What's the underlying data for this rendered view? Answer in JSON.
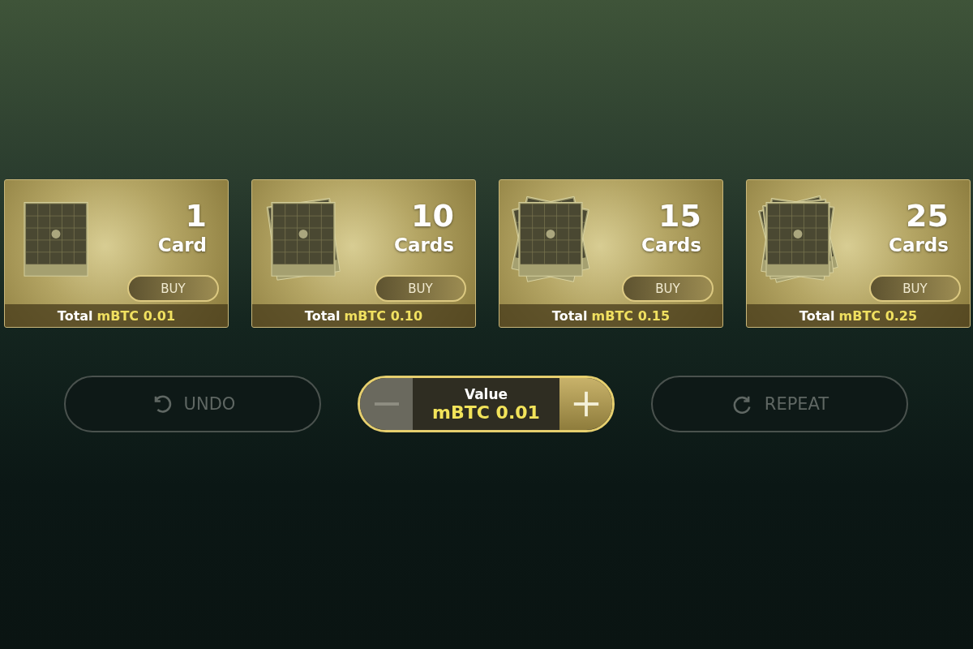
{
  "packs": [
    {
      "count": "1",
      "unit": "Card",
      "buy": "BUY",
      "total_label": "Total",
      "total_value": "mBTC 0.01"
    },
    {
      "count": "10",
      "unit": "Cards",
      "buy": "BUY",
      "total_label": "Total",
      "total_value": "mBTC 0.10"
    },
    {
      "count": "15",
      "unit": "Cards",
      "buy": "BUY",
      "total_label": "Total",
      "total_value": "mBTC 0.15"
    },
    {
      "count": "25",
      "unit": "Cards",
      "buy": "BUY",
      "total_label": "Total",
      "total_value": "mBTC 0.25"
    }
  ],
  "undo": {
    "label": "UNDO",
    "disabled": true
  },
  "value": {
    "label": "Value",
    "amount": "mBTC 0.01",
    "minus_disabled": true,
    "plus_disabled": false
  },
  "repeat": {
    "label": "REPEAT",
    "disabled": true
  }
}
